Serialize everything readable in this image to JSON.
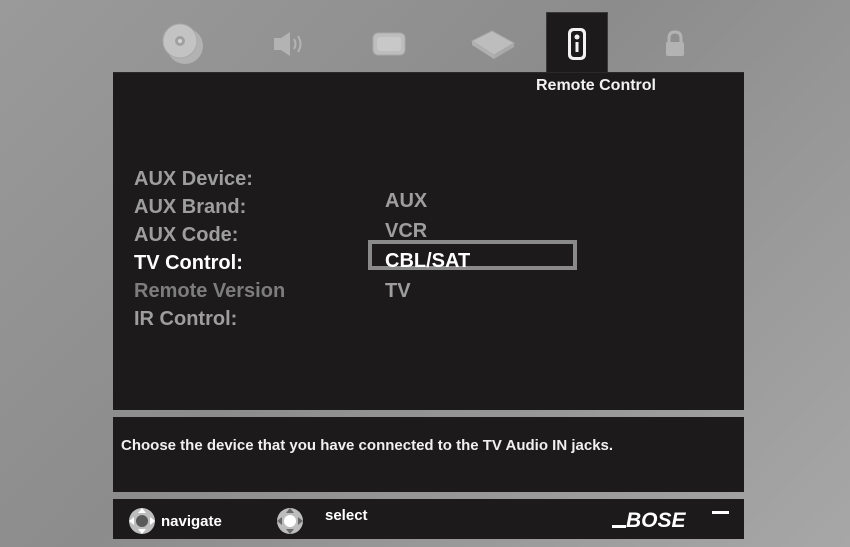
{
  "tabs": [
    {
      "icon": "disc-icon"
    },
    {
      "icon": "speaker-icon"
    },
    {
      "icon": "tv-icon"
    },
    {
      "icon": "cable-box-icon"
    },
    {
      "icon": "remote-icon",
      "active": true
    },
    {
      "icon": "lock-icon"
    }
  ],
  "panel": {
    "title": "Remote Control",
    "settings": [
      {
        "label": "AUX Device:"
      },
      {
        "label": "AUX Brand:"
      },
      {
        "label": "AUX Code:"
      },
      {
        "label": "TV Control:"
      },
      {
        "label": "Remote Version"
      },
      {
        "label": "IR Control:"
      }
    ],
    "options": [
      "AUX",
      "VCR",
      "CBL/SAT",
      "TV"
    ],
    "selected_option": "CBL/SAT"
  },
  "help": {
    "text": "Choose the device that you have connected to the TV Audio IN jacks."
  },
  "footer": {
    "navigate_label": "navigate",
    "select_label": "select",
    "logo_text": "BOSE"
  }
}
